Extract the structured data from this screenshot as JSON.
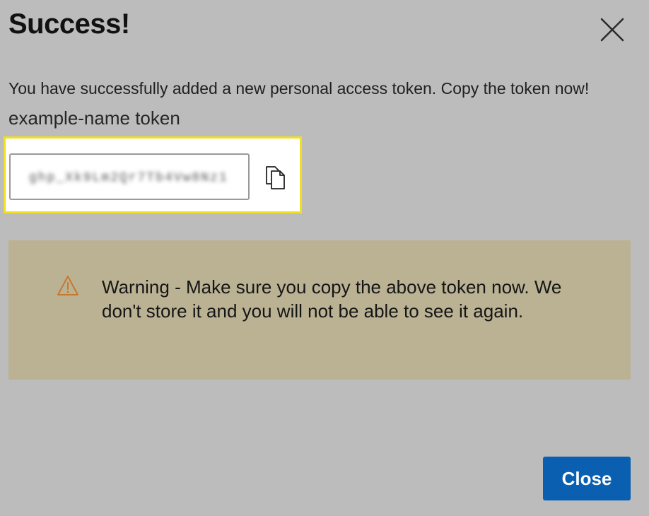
{
  "dialog": {
    "title": "Success!",
    "close_icon": "close-icon",
    "message": "You have successfully added a new personal access token. Copy the token now!",
    "token_name": "example-name token",
    "token_value": "ghp_Xk9Lm2Qr7Tb4Vw8Nz1",
    "token_obscured": true,
    "copy_icon": "copy-icon",
    "highlight_color": "#f0e020"
  },
  "warning": {
    "icon": "warning-triangle-icon",
    "text": "Warning - Make sure you copy the above token now. We don't store it and you will not be able to see it again.",
    "background": "#bbb294",
    "icon_color": "#c8782c"
  },
  "footer": {
    "close_label": "Close",
    "close_color": "#0b5fb0"
  }
}
